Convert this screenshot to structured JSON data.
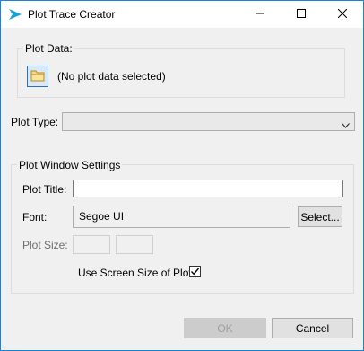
{
  "window": {
    "title": "Plot Trace Creator"
  },
  "plot_data": {
    "group_label": "Plot Data:",
    "status": "(No plot data selected)"
  },
  "plot_type": {
    "label": "Plot Type:",
    "value": ""
  },
  "settings": {
    "group_label": "Plot Window Settings",
    "title_label": "Plot Title:",
    "title_value": "",
    "font_label": "Font:",
    "font_value": "Segoe UI",
    "select_label": "Select...",
    "size_label": "Plot Size:",
    "width_value": "",
    "height_value": "",
    "screen_size_label": "Use Screen Size of Plot:",
    "screen_size_checked": true
  },
  "footer": {
    "ok_label": "OK",
    "cancel_label": "Cancel"
  },
  "icons": {
    "app": "play-arrow-icon",
    "folder": "folder-icon",
    "dropdown": "chevron-down-icon",
    "check": "check-icon"
  }
}
